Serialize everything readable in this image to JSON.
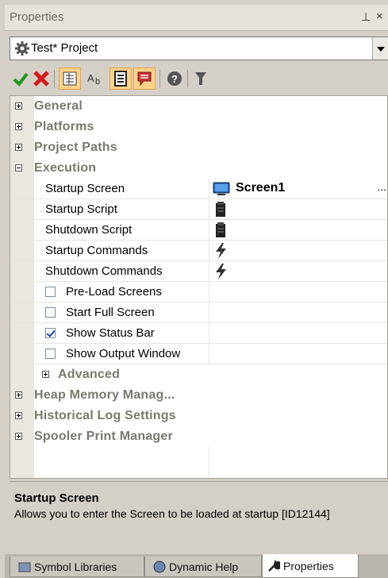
{
  "panel": {
    "title": "Properties",
    "pin_glyph": "⊥",
    "close_glyph": "×"
  },
  "object_selector": {
    "value": "Test* Project",
    "icon": "gear-icon"
  },
  "toolbar": {
    "buttons": [
      {
        "name": "apply-check-icon",
        "color": "#1a9a1a"
      },
      {
        "name": "cancel-x-icon",
        "color": "#d71919"
      },
      {
        "name": "categorized-view-icon"
      },
      {
        "name": "alphabetical-view-icon",
        "text": "A"
      },
      {
        "name": "property-pages-icon"
      },
      {
        "name": "comments-icon"
      },
      {
        "name": "help-icon",
        "text": "?"
      },
      {
        "name": "filter-icon"
      }
    ]
  },
  "grid": {
    "categories_top": [
      {
        "label": "General",
        "expanded": false
      },
      {
        "label": "Platforms",
        "expanded": false
      },
      {
        "label": "Project Paths",
        "expanded": false
      },
      {
        "label": "Execution",
        "expanded": true
      }
    ],
    "execution_props": [
      {
        "label": "Startup Screen",
        "value": "Screen1",
        "value_icon": "screen-icon"
      },
      {
        "label": "Startup Script",
        "value": "",
        "value_icon": "script-icon"
      },
      {
        "label": "Shutdown Script",
        "value": "",
        "value_icon": "script-icon"
      },
      {
        "label": "Startup Commands",
        "value": "",
        "value_icon": "lightning-icon"
      },
      {
        "label": "Shutdown Commands",
        "value": "",
        "value_icon": "lightning-icon"
      }
    ],
    "checkbox_props": [
      {
        "label": "Pre-Load Screens",
        "checked": false
      },
      {
        "label": "Start Full Screen",
        "checked": false
      },
      {
        "label": "Show Status Bar",
        "checked": true
      },
      {
        "label": "Show Output Window",
        "checked": false
      }
    ],
    "sub_category": {
      "label": "Advanced",
      "expanded": false
    },
    "categories_bottom": [
      {
        "label": "Heap Memory Manag...",
        "expanded": false
      },
      {
        "label": "Historical Log Settings",
        "expanded": false
      },
      {
        "label": "Spooler Print Manager",
        "expanded": false
      }
    ],
    "ellipsis": "..."
  },
  "description": {
    "title": "Startup Screen",
    "text": "Allows you to enter the Screen to be loaded at startup [ID12144]"
  },
  "tabs": [
    {
      "label": "Symbol Libraries",
      "active": false,
      "icon": "library-icon"
    },
    {
      "label": "Dynamic Help",
      "active": false,
      "icon": "help-globe-icon"
    },
    {
      "label": "Properties",
      "active": true,
      "icon": "wrench-icon"
    }
  ],
  "colors": {
    "accent_toggle": "#ffd28a",
    "category_text": "#7b7870"
  }
}
